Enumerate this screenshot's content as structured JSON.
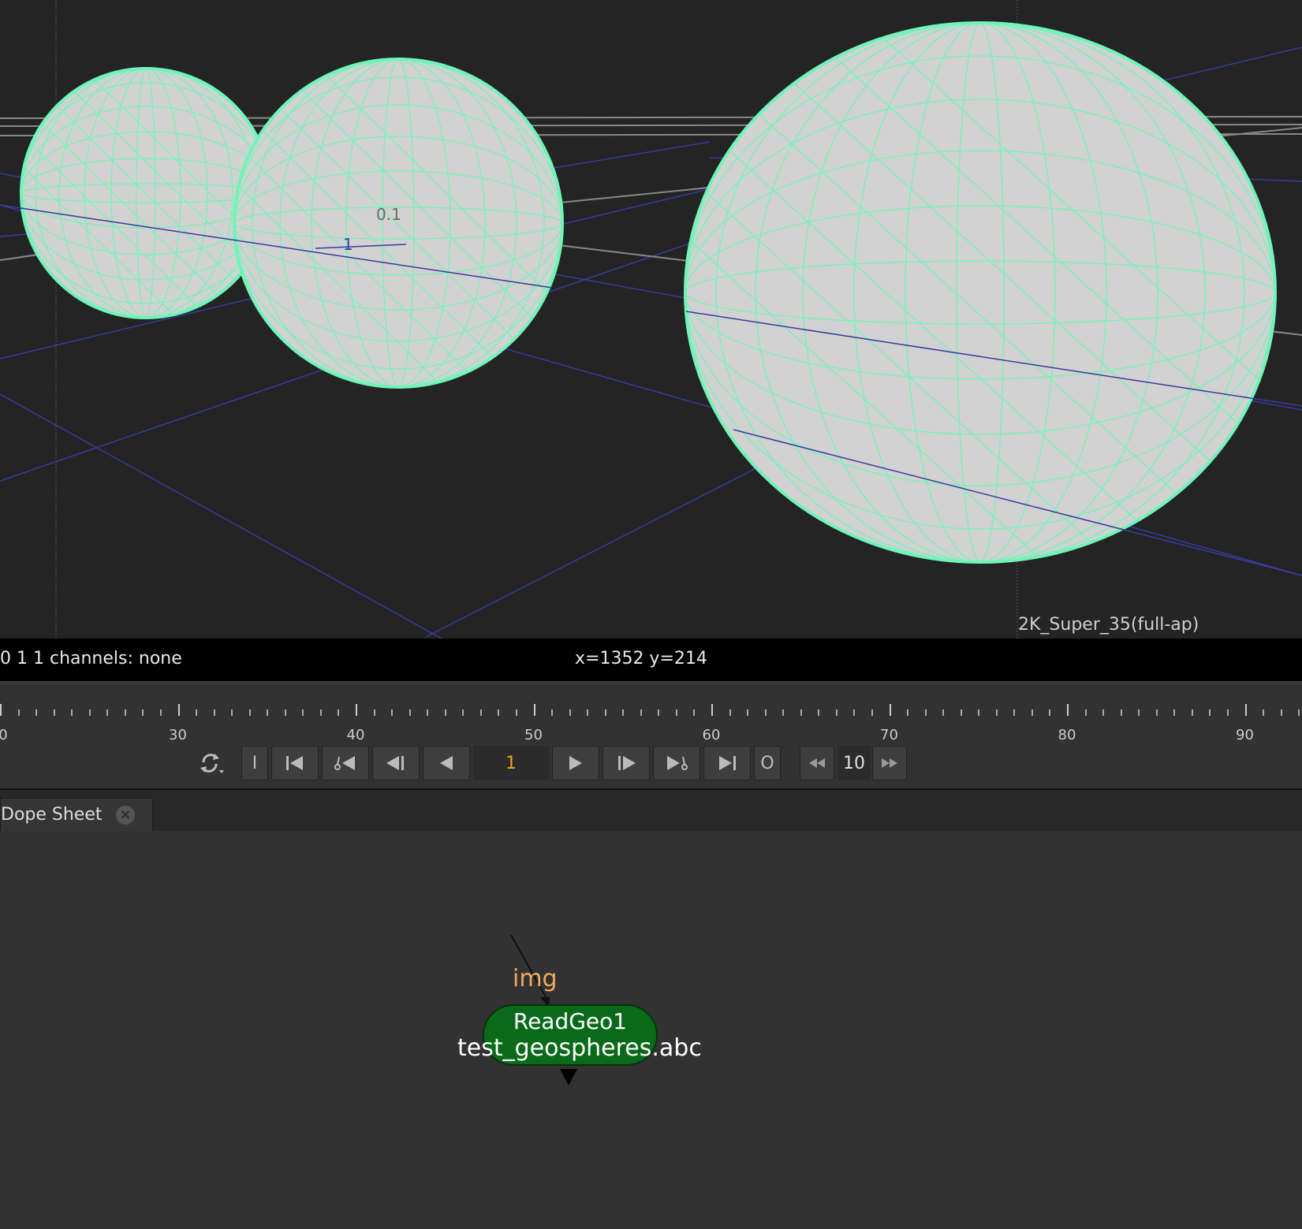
{
  "viewer": {
    "format_label": "2K_Super_35(full-ap)",
    "overlay_label_a": "0.1",
    "overlay_label_b": "1",
    "colors": {
      "background": "#242424",
      "wireframe": "#6ff5b8",
      "sphere_fill": "#d2d2d2",
      "grid": "#3a3aa0"
    }
  },
  "infobar": {
    "channels_text": "0 1 1 channels: none",
    "coords_text": "x=1352 y=214"
  },
  "timeline": {
    "tick_labels": [
      "0",
      "30",
      "40",
      "50",
      "60",
      "70",
      "80",
      "90"
    ],
    "current_frame": "1",
    "step_value": "10",
    "in_button_label": "I",
    "out_button_label": "O"
  },
  "tabs": [
    {
      "label": "Dope Sheet"
    }
  ],
  "nodegraph": {
    "input_label": "img",
    "node": {
      "name": "ReadGeo1",
      "file": "test_geospheres.abc",
      "color": "#0a6a1a"
    }
  }
}
